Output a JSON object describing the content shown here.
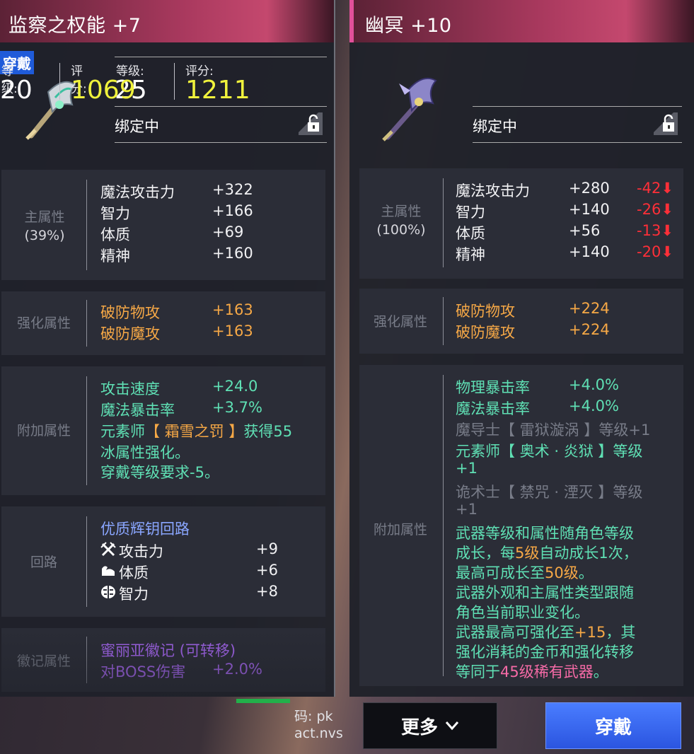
{
  "left": {
    "title": "监察之权能 +7",
    "wearing_tag": "穿戴",
    "level_label": "等级:",
    "level": "25",
    "score_label": "评分:",
    "score": "1211",
    "bind_status": "绑定中",
    "main": {
      "label": "主属性",
      "percent": "(39%)",
      "rows": [
        {
          "name": "魔法攻击力",
          "value": "+322"
        },
        {
          "name": "智力",
          "value": "+166"
        },
        {
          "name": "体质",
          "value": "+69"
        },
        {
          "name": "精神",
          "value": "+160"
        }
      ]
    },
    "enhance": {
      "label": "强化属性",
      "rows": [
        {
          "name": "破防物攻",
          "value": "+163"
        },
        {
          "name": "破防魔攻",
          "value": "+163"
        }
      ]
    },
    "extra": {
      "label": "附加属性",
      "rows": [
        {
          "name": "攻击速度",
          "value": "+24.0"
        },
        {
          "name": "魔法暴击率",
          "value": "+3.7%"
        }
      ],
      "line1_a": "元素师",
      "line1_b": "【 霜雪之罚 】",
      "line1_c": "获得55",
      "line2": "冰属性强化。",
      "line3": "穿戴等级要求-5。"
    },
    "circuit": {
      "label": "回路",
      "name": "优质辉钥回路",
      "rows": [
        {
          "icon": "crossed-swords-icon",
          "name": "攻击力",
          "value": "+9"
        },
        {
          "icon": "flexed-arm-icon",
          "name": "体质",
          "value": "+6"
        },
        {
          "icon": "brain-icon",
          "name": "智力",
          "value": "+8"
        }
      ]
    },
    "emblem": {
      "label": "徽记属性",
      "name": "蜜丽亚徽记 (可转移)",
      "row_name": "对BOSS伤害",
      "row_value": "+2.0%"
    }
  },
  "right": {
    "title": "幽冥 +10",
    "level_label": "等级:",
    "level": "20",
    "score_label": "评分:",
    "score": "1069",
    "bind_status": "绑定中",
    "main": {
      "label": "主属性",
      "percent": "(100%)",
      "rows": [
        {
          "name": "魔法攻击力",
          "value": "+280",
          "diff": "-42"
        },
        {
          "name": "智力",
          "value": "+140",
          "diff": "-26"
        },
        {
          "name": "体质",
          "value": "+56",
          "diff": "-13"
        },
        {
          "name": "精神",
          "value": "+140",
          "diff": "-20"
        }
      ]
    },
    "enhance": {
      "label": "强化属性",
      "rows": [
        {
          "name": "破防物攻",
          "value": "+224"
        },
        {
          "name": "破防魔攻",
          "value": "+224"
        }
      ]
    },
    "extra": {
      "label": "附加属性",
      "rows": [
        {
          "name": "物理暴击率",
          "value": "+4.0%"
        },
        {
          "name": "魔法暴击率",
          "value": "+4.0%"
        }
      ],
      "l3": "魔导士【 雷狱漩涡 】等级+1",
      "l4": "元素师【 奥术 · 炎狱 】等级",
      "l5": "+1",
      "l6": "诡术士【 禁咒 · 湮灭 】等级",
      "l7": "+1",
      "l8": "武器等级和属性随角色等级",
      "l9_a": "成长，每",
      "l9_b": "5级",
      "l9_c": "自动成长1次，",
      "l10_a": "最高可成长至",
      "l10_b": "50级",
      "l10_c": "。",
      "l11": "武器外观和主属性类型跟随",
      "l12": "角色当前职业变化。",
      "l13_a": "武器最高可强化至",
      "l13_b": "+15",
      "l13_c": "，其",
      "l14": "强化消耗的金币和强化转移",
      "l15_a": "等同于",
      "l15_b": "45级稀有武器",
      "l15_c": "。"
    }
  },
  "buttons": {
    "more": "更多",
    "wear": "穿戴"
  },
  "bottom_text": {
    "line1": "码: pk",
    "line2": "act.nvs"
  }
}
